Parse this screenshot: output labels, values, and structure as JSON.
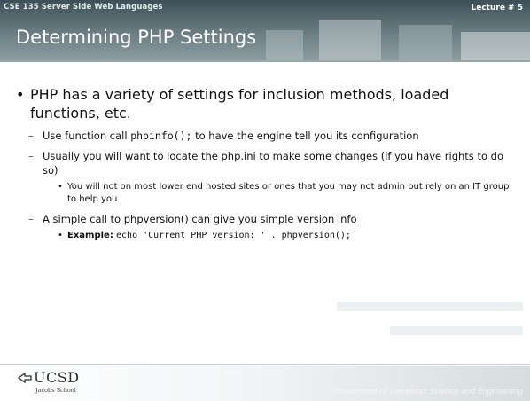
{
  "header": {
    "course": "CSE 135   Server Side Web Languages",
    "lecture": "Lecture # 5",
    "title": "Determining PHP Settings"
  },
  "content": {
    "bullet": "PHP has a variety of settings for inclusion methods, loaded functions, etc.",
    "sub1": {
      "pre": "Use function call ",
      "code": "phpinfo();",
      "post": " to have the engine tell you its configuration"
    },
    "sub2": "Usually you will want to locate the php.ini to make some changes (if you have rights to do so)",
    "sub2_child": "You will not on most lower end hosted sites or ones that you may not admin but rely on an IT group to help you",
    "sub3": "A simple call to phpversion() can give you simple version info",
    "sub3_child": {
      "label": "Example:",
      "code": "echo 'Current PHP version: ' . phpversion();"
    }
  },
  "footer": {
    "logo_name": "UCSD",
    "logo_sub": "Jacobs School",
    "department": "Department of Computer Science and Engineering"
  }
}
